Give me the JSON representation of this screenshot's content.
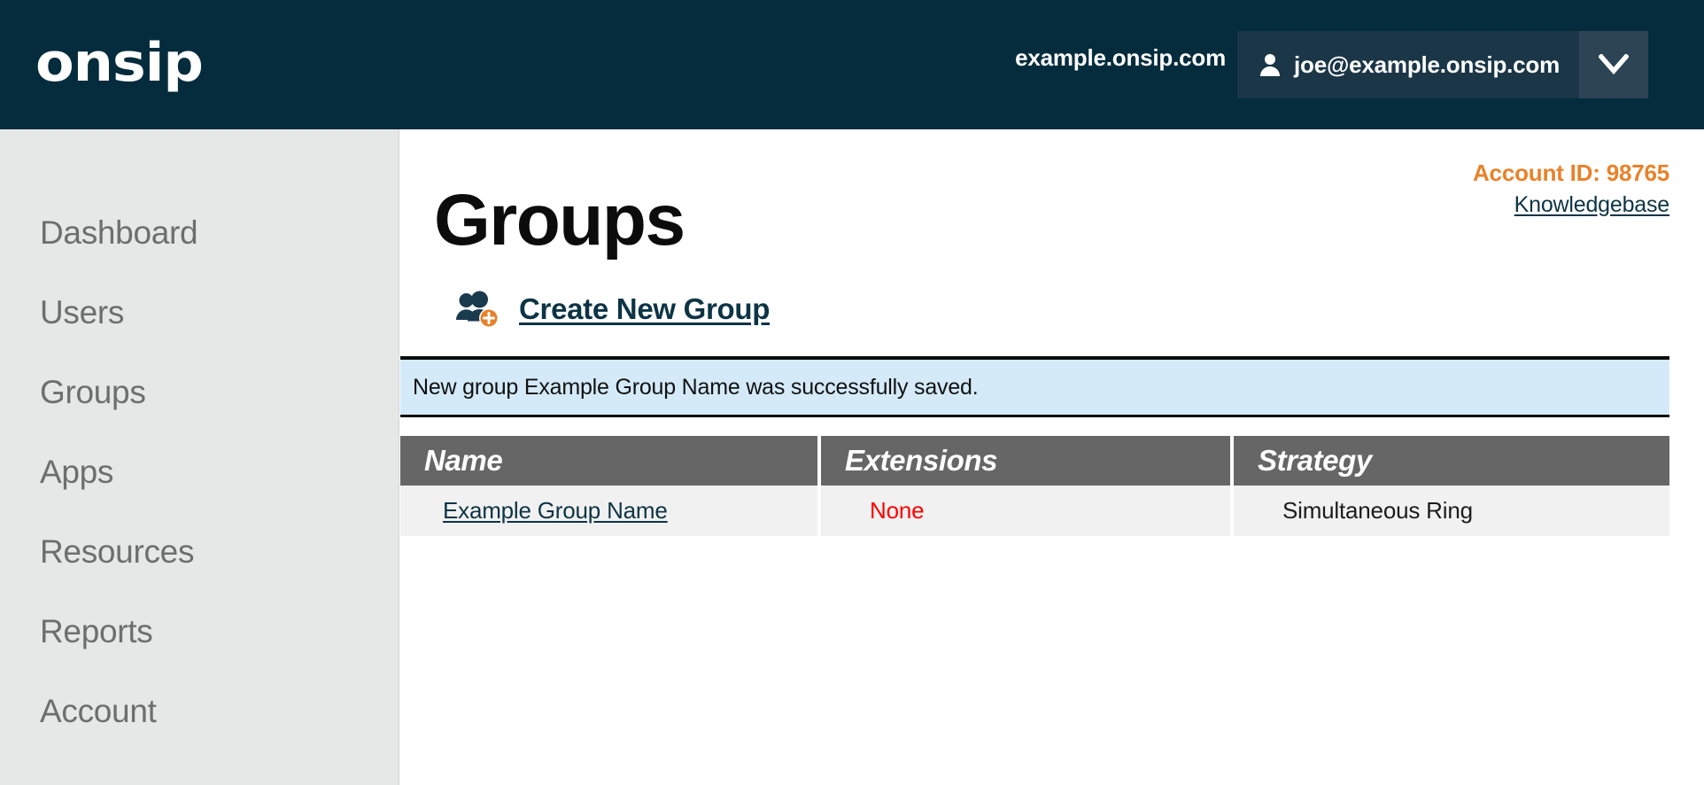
{
  "header": {
    "logo_text": "onsip",
    "logo_icon": "onsip-wordmark",
    "domain": "example.onsip.com",
    "user_email": "joe@example.onsip.com",
    "avatar_icon": "person-icon",
    "caret_icon": "chevron-down-icon",
    "bg_color": "#042c3c",
    "menu_color": "#1a3647",
    "caret_bg_color": "#2c4454"
  },
  "sidebar": {
    "bg_color": "#e6e8e7",
    "text_color": "#6e6e6e",
    "items": [
      {
        "label": "Dashboard"
      },
      {
        "label": "Users"
      },
      {
        "label": "Groups"
      },
      {
        "label": "Apps"
      },
      {
        "label": "Resources"
      },
      {
        "label": "Reports"
      },
      {
        "label": "Account"
      }
    ]
  },
  "main": {
    "account_id": "Account ID: 98765",
    "account_id_color": "#e8822a",
    "knowledgebase_label": "Knowledgebase",
    "page_title": "Groups",
    "create_new_group_label": "Create New Group",
    "create_icon": "group-add-icon",
    "link_color": "#0d3445",
    "flash": {
      "message": "New group Example Group Name was successfully saved.",
      "bg_color": "#d4eaf8",
      "border_color": "#0c0c0c"
    },
    "table": {
      "header_bg_color": "#666666",
      "row_bg_color": "#f1f1f1",
      "columns": [
        {
          "label": "Name"
        },
        {
          "label": "Extensions"
        },
        {
          "label": "Strategy"
        }
      ],
      "rows": [
        {
          "name": "Example Group Name",
          "extensions": "None",
          "extensions_color": "#ff0000",
          "strategy": "Simultaneous Ring"
        }
      ]
    }
  }
}
